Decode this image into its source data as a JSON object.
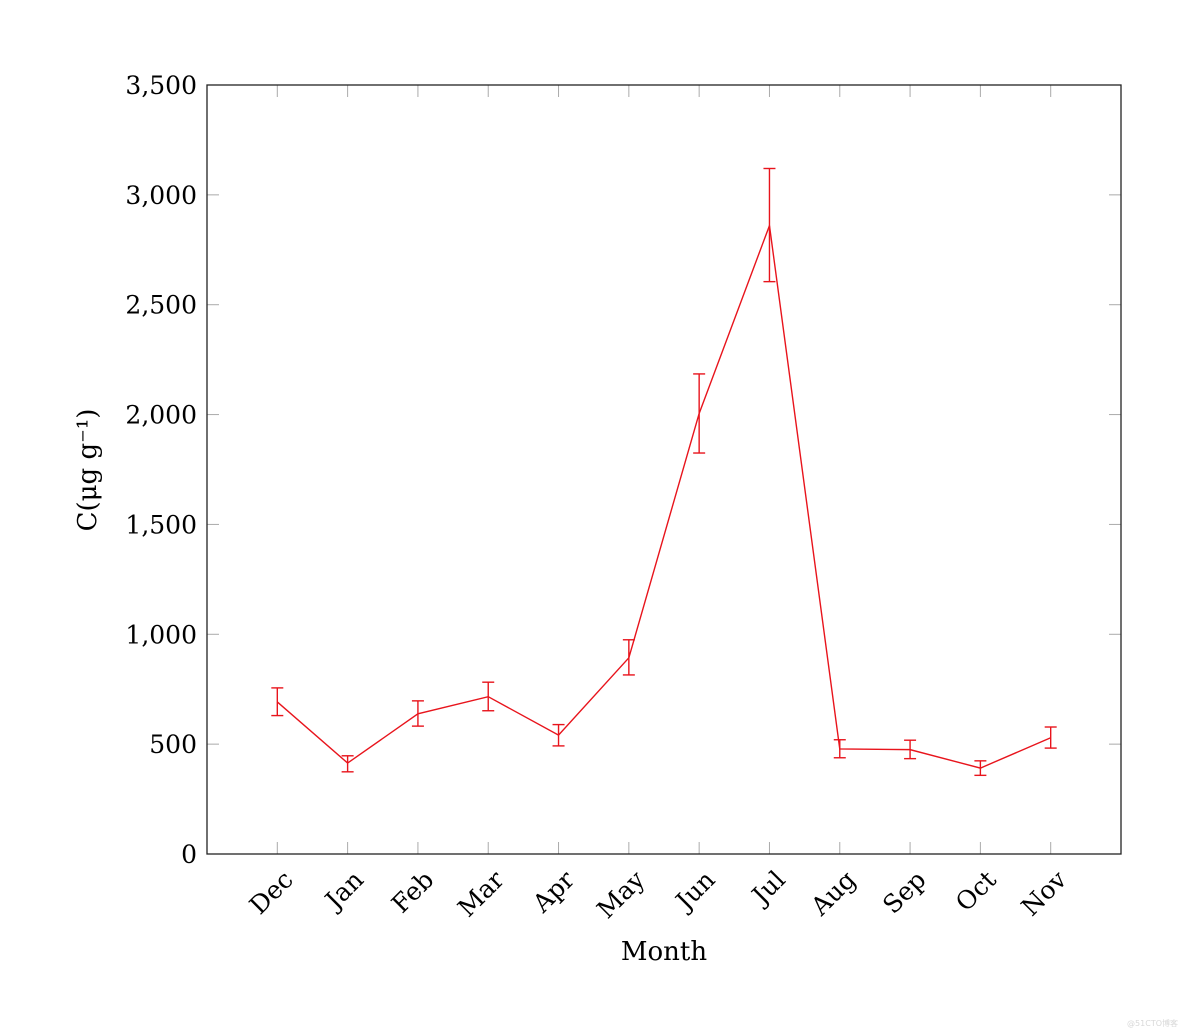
{
  "chart_data": {
    "type": "line",
    "title": "",
    "xlabel": "Month",
    "ylabel": "C(μg g⁻¹)",
    "categories": [
      "Dec",
      "Jan",
      "Feb",
      "Mar",
      "Apr",
      "May",
      "Jun",
      "Jul",
      "Aug",
      "Sep",
      "Oct",
      "Nov"
    ],
    "series": [
      {
        "name": "C",
        "color": "#e8141c",
        "values": [
          692,
          414,
          638,
          716,
          541,
          893,
          2005,
          2860,
          478,
          475,
          391,
          529
        ],
        "error_upper": [
          756,
          447,
          697,
          782,
          589,
          975,
          2185,
          3120,
          520,
          518,
          424,
          578
        ],
        "error_lower": [
          630,
          374,
          582,
          652,
          492,
          815,
          1825,
          2605,
          438,
          434,
          358,
          482
        ]
      }
    ],
    "ylim": [
      0,
      3500
    ],
    "xlim_index": [
      -1,
      12
    ],
    "yticks": [
      0,
      500,
      1000,
      1500,
      2000,
      2500,
      3000,
      3500
    ],
    "ytick_labels": [
      "0",
      "500",
      "1,000",
      "1,500",
      "2,000",
      "2,500",
      "3,000",
      "3,500"
    ],
    "grid": false,
    "legend": "none"
  },
  "watermark": "@51CTO博客"
}
